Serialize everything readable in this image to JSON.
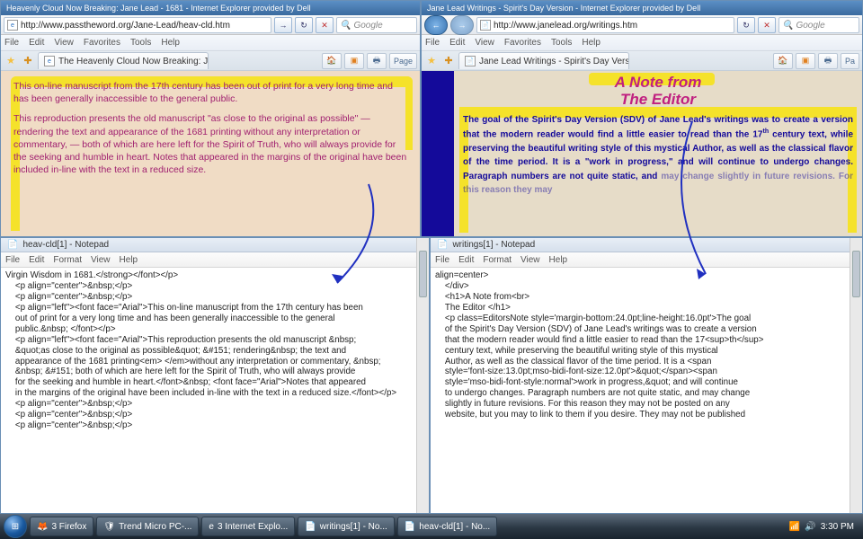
{
  "ie_left": {
    "title": "Heavenly Cloud Now Breaking: Jane Lead - 1681 - Internet Explorer provided by Dell",
    "url": "http://www.passtheword.org/Jane-Lead/heav-cld.htm",
    "search_placeholder": "Google",
    "menus": [
      "File",
      "Edit",
      "View",
      "Favorites",
      "Tools",
      "Help"
    ],
    "tab_label": "The Heavenly Cloud Now Breaking: Ja...",
    "toolbar_page": "Page",
    "content_p1": "This on-line manuscript from the 17th century has been out of print for a very long time and has been generally inaccessible to the general public.",
    "content_p2": "This reproduction presents the old manuscript   \"as close to the original as possible\" — rendering  the text and appearance of the 1681 printing without any interpretation or commentary,      — both of which are here left for the Spirit of Truth, who will always provide for the seeking and humble in heart.  Notes that appeared in the margins of the original have been included in-line with the text in a reduced size."
  },
  "ie_right": {
    "title": "Jane Lead Writings - Spirit's Day Version - Internet Explorer provided by Dell",
    "url": "http://www.janelead.org/writings.htm",
    "search_placeholder": "Google",
    "menus": [
      "File",
      "Edit",
      "View",
      "Favorites",
      "Tools",
      "Help"
    ],
    "tab_label": "Jane Lead Writings - Spirit's Day Version",
    "toolbar_page": "Pa",
    "heading_l1": "A Note from",
    "heading_l2": "The Editor",
    "para_a": "The goal of the Spirit's Day Version (SDV) of Jane Lead's writings was to create a version that the modern reader would find a little easier to read than the 17",
    "para_sup": "th",
    "para_b": " century text, while preserving the beautiful writing style of this mystical Author, as well as the classical flavor of the time period. It is a \"work in progress,\" and will continue to undergo changes. Paragraph numbers are not quite static, and",
    "para_c": "may change slightly in future revisions. For this reason they may"
  },
  "np_left": {
    "title": "heav-cld[1] - Notepad",
    "menus": [
      "File",
      "Edit",
      "Format",
      "View",
      "Help"
    ],
    "text": "Virgin Wisdom in 1681.</strong></font></p>\n    <p align=\"center\">&nbsp;</p>\n    <p align=\"center\">&nbsp;</p>\n    <p align=\"left\"><font face=\"Arial\">This on-line manuscript from the 17th century has been\n    out of print for a very long time and has been generally inaccessible to the general\n    public.&nbsp; </font></p>\n    <p align=\"left\"><font face=\"Arial\">This reproduction presents the old manuscript &nbsp;\n    &quot;as close to the original as possible&quot; &#151; rendering&nbsp; the text and\n    appearance of the 1681 printing<em> </em>without any interpretation or commentary, &nbsp;\n    &nbsp; &#151; both of which are here left for the Spirit of Truth, who will always provide\n    for the seeking and humble in heart.</font>&nbsp; <font face=\"Arial\">Notes that appeared\n    in the margins of the original have been included in-line with the text in a reduced size.</font></p>\n    <p align=\"center\">&nbsp;</p>\n    <p align=\"center\">&nbsp;</p>\n    <p align=\"center\">&nbsp;</p>"
  },
  "np_right": {
    "title": "writings[1] - Notepad",
    "menus": [
      "File",
      "Edit",
      "Format",
      "View",
      "Help"
    ],
    "text": "align=center>\n    </div>\n    <h1>A Note from<br>\n    The Editor </h1>\n    <p class=EditorsNote style='margin-bottom:24.0pt;line-height:16.0pt'>The goal\n    of the Spirit's Day Version (SDV) of Jane Lead's writings was to create a version\n    that the modern reader would find a little easier to read than the 17<sup>th</sup>\n    century text, while preserving the beautiful writing style of this mystical\n    Author, as well as the classical flavor of the time period. It is a <span\n    style='font-size:13.0pt;mso-bidi-font-size:12.0pt'>&quot;</span><span\n    style='mso-bidi-font-style:normal'>work in progress,&quot; and will continue\n    to undergo changes. Paragraph numbers are not quite static, and may change\n    slightly in future revisions. For this reason they may not be posted on any\n    website, but you may to link to them if you desire. They may not be published"
  },
  "taskbar": {
    "items": [
      {
        "icon": "🦊",
        "label": "3 Firefox"
      },
      {
        "icon": "🛡",
        "label": "Trend Micro PC-..."
      },
      {
        "icon": "e",
        "label": "3 Internet Explo..."
      },
      {
        "icon": "📄",
        "label": "writings[1] - No..."
      },
      {
        "icon": "📄",
        "label": "heav-cld[1] - No..."
      }
    ],
    "time": "3:30 PM"
  }
}
